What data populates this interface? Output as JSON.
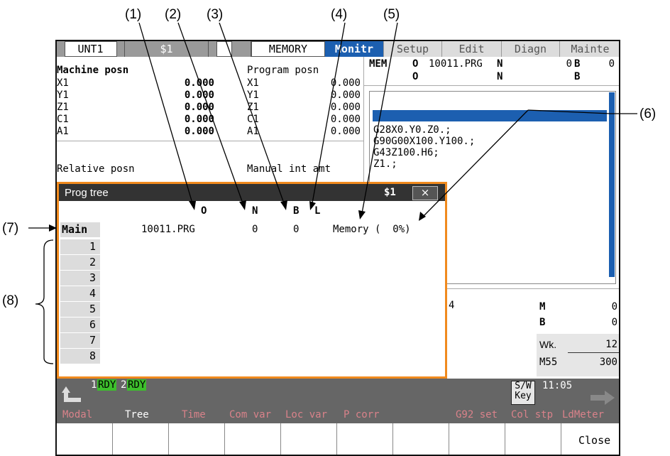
{
  "callouts": [
    "(1)",
    "(2)",
    "(3)",
    "(4)",
    "(5)",
    "(6)",
    "(7)",
    "(8)"
  ],
  "tabs": {
    "unit": "UNT1",
    "sys": "$1",
    "mode": "MEMORY",
    "monitor": "Monitr",
    "setup": "Setup",
    "edit": "Edit",
    "diagn": "Diagn",
    "mainte": "Mainte"
  },
  "machine_posn": {
    "title": "Machine posn",
    "axes": [
      "X1",
      "Y1",
      "Z1",
      "C1",
      "A1"
    ],
    "values": [
      "0.000",
      "0.000",
      "0.000",
      "0.000",
      "0.000"
    ]
  },
  "program_posn": {
    "title": "Program posn",
    "axes": [
      "X1",
      "Y1",
      "Z1",
      "C1",
      "A1"
    ],
    "values": [
      "0.000",
      "0.000",
      "0.000",
      "0.000",
      "0.000"
    ]
  },
  "relative_posn": {
    "title": "Relative posn"
  },
  "manual_int": {
    "title": "Manual int amt"
  },
  "program_header": {
    "mem": "MEM",
    "o_label": "O",
    "o_value": "10011.PRG",
    "n_label": "N",
    "n_value": "0",
    "b_label": "B",
    "b_value": "0",
    "o_label2": "O",
    "n_label2": "N",
    "b_label2": "B"
  },
  "program_lines": [
    "G28X0.Y0.Z0.;",
    "G90G00X100.Y100.;",
    "G43Z100.H6;",
    "Z1.;"
  ],
  "modal_right": {
    "m_label": "M",
    "m_value": "0",
    "b_label": "B",
    "b_value": "0",
    "wk_label": "Wk.",
    "wk_value": "12",
    "m55_label": "M55",
    "m55_value": "300",
    "left_val": "4"
  },
  "prog_tree": {
    "title": "Prog tree",
    "sys": "$1",
    "close": "×",
    "col_o": "O",
    "col_n": "N",
    "col_b": "B",
    "col_l": "L",
    "main_label": "Main",
    "main_o": "10011.PRG",
    "main_n": "0",
    "main_b": "0",
    "main_status": "Memory (  0%)",
    "rows": [
      "1",
      "2",
      "3",
      "4",
      "5",
      "6",
      "7",
      "8"
    ]
  },
  "status_bar": {
    "rdy1_num": "1",
    "rdy1": "RDY",
    "rdy2_num": "2",
    "rdy2": "RDY",
    "sw_key": "S/W\nKey",
    "time": "11:05"
  },
  "function_keys": [
    "Modal",
    "Tree",
    "Time",
    "Com var",
    "Loc var",
    "P corr",
    "",
    "G92 set",
    "Col stp",
    "LdMeter"
  ],
  "bottom_keys": [
    "",
    "",
    "",
    "",
    "",
    "",
    "",
    "",
    "",
    "Close"
  ],
  "colors": {
    "accent_blue": "#1c5fb0",
    "highlight_orange": "#f08a1e",
    "ready_green": "#3dbf2c"
  }
}
